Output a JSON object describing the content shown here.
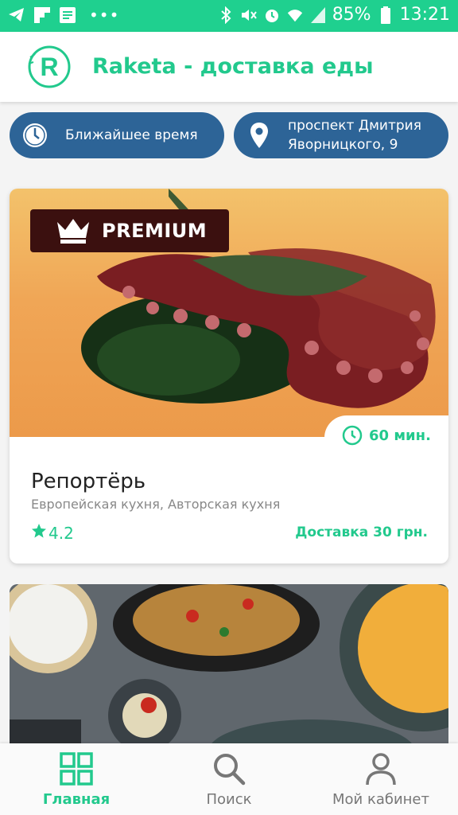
{
  "status_bar": {
    "battery": "85%",
    "time": "13:21",
    "left_icons": [
      "telegram-icon",
      "flipboard-icon",
      "notes-icon"
    ],
    "right_icons": [
      "bluetooth-icon",
      "mute-icon",
      "alarm-icon",
      "wifi-icon",
      "signal-icon",
      "battery-icon"
    ]
  },
  "app_bar": {
    "title": "Raketa - доставка еды"
  },
  "filters": {
    "time_label": "Ближайшее время",
    "address_line1": "проспект Дмитрия",
    "address_line2": "Яворницкого, 9"
  },
  "restaurants": [
    {
      "badge": "PREMIUM",
      "delivery_time": "60 мин.",
      "name": "Репортёрь",
      "cuisine": "Европейская кухня, Авторская кухня",
      "rating": "4.2",
      "delivery_price": "Доставка 30 грн."
    }
  ],
  "bottom_nav": {
    "home": "Главная",
    "search": "Поиск",
    "account": "Мой кабинет"
  },
  "colors": {
    "accent": "#22c98d",
    "status_bar": "#1fd08f",
    "chip": "#2d6497",
    "premium_badge": "#3b100f"
  }
}
